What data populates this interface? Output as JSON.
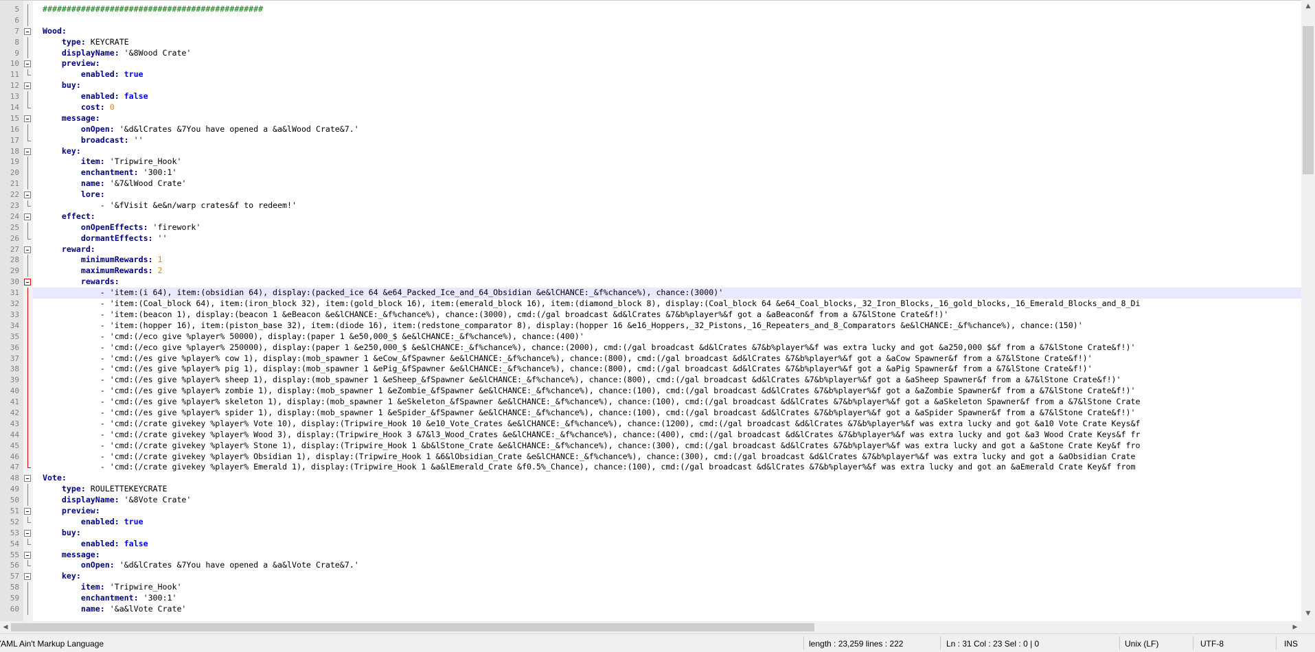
{
  "editor": {
    "lines": [
      {
        "n": "5",
        "fold": "line-v",
        "parts": [
          [
            "cmt",
            "##############################################"
          ]
        ]
      },
      {
        "n": "6",
        "fold": "line-v",
        "parts": []
      },
      {
        "n": "7",
        "fold": "box",
        "parts": [
          [
            "key",
            "Wood:"
          ]
        ]
      },
      {
        "n": "8",
        "fold": "line-v",
        "parts": [
          [
            "",
            "    "
          ],
          [
            "key",
            "type:"
          ],
          [
            "str",
            " KEYCRATE"
          ]
        ]
      },
      {
        "n": "9",
        "fold": "line-v",
        "parts": [
          [
            "",
            "    "
          ],
          [
            "key",
            "displayName:"
          ],
          [
            "str",
            " '&8Wood Crate'"
          ]
        ]
      },
      {
        "n": "10",
        "fold": "box",
        "parts": [
          [
            "",
            "    "
          ],
          [
            "key",
            "preview:"
          ]
        ]
      },
      {
        "n": "11",
        "fold": "end",
        "parts": [
          [
            "",
            "        "
          ],
          [
            "key",
            "enabled:"
          ],
          [
            "bool",
            " true"
          ]
        ]
      },
      {
        "n": "12",
        "fold": "box",
        "parts": [
          [
            "",
            "    "
          ],
          [
            "key",
            "buy:"
          ]
        ]
      },
      {
        "n": "13",
        "fold": "line-v",
        "parts": [
          [
            "",
            "        "
          ],
          [
            "key",
            "enabled:"
          ],
          [
            "bool",
            " false"
          ]
        ]
      },
      {
        "n": "14",
        "fold": "end",
        "parts": [
          [
            "",
            "        "
          ],
          [
            "key",
            "cost:"
          ],
          [
            "num",
            " 0"
          ]
        ]
      },
      {
        "n": "15",
        "fold": "box",
        "parts": [
          [
            "",
            "    "
          ],
          [
            "key",
            "message:"
          ]
        ]
      },
      {
        "n": "16",
        "fold": "line-v",
        "parts": [
          [
            "",
            "        "
          ],
          [
            "key",
            "onOpen:"
          ],
          [
            "str",
            " '&d&lCrates &7You have opened a &a&lWood Crate&7.'"
          ]
        ]
      },
      {
        "n": "17",
        "fold": "end",
        "parts": [
          [
            "",
            "        "
          ],
          [
            "key",
            "broadcast:"
          ],
          [
            "str",
            " ''"
          ]
        ]
      },
      {
        "n": "18",
        "fold": "box",
        "parts": [
          [
            "",
            "    "
          ],
          [
            "key",
            "key:"
          ]
        ]
      },
      {
        "n": "19",
        "fold": "line-v",
        "parts": [
          [
            "",
            "        "
          ],
          [
            "key",
            "item:"
          ],
          [
            "str",
            " 'Tripwire_Hook'"
          ]
        ]
      },
      {
        "n": "20",
        "fold": "line-v",
        "parts": [
          [
            "",
            "        "
          ],
          [
            "key",
            "enchantment:"
          ],
          [
            "str",
            " '300:1'"
          ]
        ]
      },
      {
        "n": "21",
        "fold": "line-v",
        "parts": [
          [
            "",
            "        "
          ],
          [
            "key",
            "name:"
          ],
          [
            "str",
            " '&7&lWood Crate'"
          ]
        ]
      },
      {
        "n": "22",
        "fold": "box",
        "parts": [
          [
            "",
            "        "
          ],
          [
            "key",
            "lore:"
          ]
        ]
      },
      {
        "n": "23",
        "fold": "end",
        "parts": [
          [
            "",
            "            "
          ],
          [
            "str",
            "- '&fVisit &e&n/warp crates&f to redeem!'"
          ]
        ]
      },
      {
        "n": "24",
        "fold": "box",
        "parts": [
          [
            "",
            "    "
          ],
          [
            "key",
            "effect:"
          ]
        ]
      },
      {
        "n": "25",
        "fold": "line-v",
        "parts": [
          [
            "",
            "        "
          ],
          [
            "key",
            "onOpenEffects:"
          ],
          [
            "str",
            " 'firework'"
          ]
        ]
      },
      {
        "n": "26",
        "fold": "end",
        "parts": [
          [
            "",
            "        "
          ],
          [
            "key",
            "dormantEffects:"
          ],
          [
            "str",
            " ''"
          ]
        ]
      },
      {
        "n": "27",
        "fold": "box",
        "parts": [
          [
            "",
            "    "
          ],
          [
            "key",
            "reward:"
          ]
        ]
      },
      {
        "n": "28",
        "fold": "line-v",
        "parts": [
          [
            "",
            "        "
          ],
          [
            "key",
            "minimumRewards:"
          ],
          [
            "num",
            " 1"
          ]
        ]
      },
      {
        "n": "29",
        "fold": "line-v",
        "parts": [
          [
            "",
            "        "
          ],
          [
            "key",
            "maximumRewards:"
          ],
          [
            "num",
            " 2"
          ]
        ]
      },
      {
        "n": "30",
        "fold": "box red",
        "parts": [
          [
            "",
            "        "
          ],
          [
            "key",
            "rewards:"
          ]
        ]
      },
      {
        "n": "31",
        "fold": "line-v red",
        "current": true,
        "parts": [
          [
            "",
            "            "
          ],
          [
            "str",
            "- 'item:(i 64), item:(obsidian 64), display:(packed_ice 64 &e64_Packed_Ice_and_64_Obsidian &e&lCHANCE:_&f%chance%), chance:(3000)'"
          ]
        ]
      },
      {
        "n": "32",
        "fold": "line-v red",
        "parts": [
          [
            "",
            "            "
          ],
          [
            "str",
            "- 'item:(Coal_block 64), item:(iron_block 32), item:(gold_block 16), item:(emerald_block 16), item:(diamond_block 8), display:(Coal_block 64 &e64_Coal_blocks,_32_Iron_Blocks,_16_gold_blocks,_16_Emerald_Blocks_and_8_Di"
          ]
        ]
      },
      {
        "n": "33",
        "fold": "line-v red",
        "parts": [
          [
            "",
            "            "
          ],
          [
            "str",
            "- 'item:(beacon 1), display:(beacon 1 &eBeacon &e&lCHANCE:_&f%chance%), chance:(3000), cmd:(/gal broadcast &d&lCrates &7&b%player%&f got a &aBeacon&f from a &7&lStone Crate&f!)'"
          ]
        ]
      },
      {
        "n": "34",
        "fold": "line-v red",
        "parts": [
          [
            "",
            "            "
          ],
          [
            "str",
            "- 'item:(hopper 16), item:(piston_base 32), item:(diode 16), item:(redstone_comparator 8), display:(hopper 16 &e16_Hoppers,_32_Pistons,_16_Repeaters_and_8_Comparators &e&lCHANCE:_&f%chance%), chance:(150)'"
          ]
        ]
      },
      {
        "n": "35",
        "fold": "line-v red",
        "parts": [
          [
            "",
            "            "
          ],
          [
            "str",
            "- 'cmd:(/eco give %player% 50000), display:(paper 1 &e50,000_$ &e&lCHANCE:_&f%chance%), chance:(400)'"
          ]
        ]
      },
      {
        "n": "36",
        "fold": "line-v red",
        "parts": [
          [
            "",
            "            "
          ],
          [
            "str",
            "- 'cmd:(/eco give %player% 250000), display:(paper 1 &e250,000_$ &e&lCHANCE:_&f%chance%), chance:(2000), cmd:(/gal broadcast &d&lCrates &7&b%player%&f was extra lucky and got &a250,000 $&f from a &7&lStone Crate&f!)'"
          ]
        ]
      },
      {
        "n": "37",
        "fold": "line-v red",
        "parts": [
          [
            "",
            "            "
          ],
          [
            "str",
            "- 'cmd:(/es give %player% cow 1), display:(mob_spawner 1 &eCow_&fSpawner &e&lCHANCE:_&f%chance%), chance:(800), cmd:(/gal broadcast &d&lCrates &7&b%player%&f got a &aCow Spawner&f from a &7&lStone Crate&f!)'"
          ]
        ]
      },
      {
        "n": "38",
        "fold": "line-v red",
        "parts": [
          [
            "",
            "            "
          ],
          [
            "str",
            "- 'cmd:(/es give %player% pig 1), display:(mob_spawner 1 &ePig_&fSpawner &e&lCHANCE:_&f%chance%), chance:(800), cmd:(/gal broadcast &d&lCrates &7&b%player%&f got a &aPig Spawner&f from a &7&lStone Crate&f!)'"
          ]
        ]
      },
      {
        "n": "39",
        "fold": "line-v red",
        "parts": [
          [
            "",
            "            "
          ],
          [
            "str",
            "- 'cmd:(/es give %player% sheep 1), display:(mob_spawner 1 &eSheep_&fSpawner &e&lCHANCE:_&f%chance%), chance:(800), cmd:(/gal broadcast &d&lCrates &7&b%player%&f got a &aSheep Spawner&f from a &7&lStone Crate&f!)'"
          ]
        ]
      },
      {
        "n": "40",
        "fold": "line-v red",
        "parts": [
          [
            "",
            "            "
          ],
          [
            "str",
            "- 'cmd:(/es give %player% zombie 1), display:(mob_spawner 1 &eZombie_&fSpawner &e&lCHANCE:_&f%chance%), chance:(100), cmd:(/gal broadcast &d&lCrates &7&b%player%&f got a &aZombie Spawner&f from a &7&lStone Crate&f!)'"
          ]
        ]
      },
      {
        "n": "41",
        "fold": "line-v red",
        "parts": [
          [
            "",
            "            "
          ],
          [
            "str",
            "- 'cmd:(/es give %player% skeleton 1), display:(mob_spawner 1 &eSkeleton_&fSpawner &e&lCHANCE:_&f%chance%), chance:(100), cmd:(/gal broadcast &d&lCrates &7&b%player%&f got a &aSkeleton Spawner&f from a &7&lStone Crate"
          ]
        ]
      },
      {
        "n": "42",
        "fold": "line-v red",
        "parts": [
          [
            "",
            "            "
          ],
          [
            "str",
            "- 'cmd:(/es give %player% spider 1), display:(mob_spawner 1 &eSpider_&fSpawner &e&lCHANCE:_&f%chance%), chance:(100), cmd:(/gal broadcast &d&lCrates &7&b%player%&f got a &aSpider Spawner&f from a &7&lStone Crate&f!)'"
          ]
        ]
      },
      {
        "n": "43",
        "fold": "line-v red",
        "parts": [
          [
            "",
            "            "
          ],
          [
            "str",
            "- 'cmd:(/crate givekey %player% Vote 10), display:(Tripwire_Hook 10 &e10_Vote_Crates &e&lCHANCE:_&f%chance%), chance:(1200), cmd:(/gal broadcast &d&lCrates &7&b%player%&f was extra lucky and got &a10 Vote Crate Keys&f"
          ]
        ]
      },
      {
        "n": "44",
        "fold": "line-v red",
        "parts": [
          [
            "",
            "            "
          ],
          [
            "str",
            "- 'cmd:(/crate givekey %player% Wood 3), display:(Tripwire_Hook 3 &7&l3_Wood_Crates &e&lCHANCE:_&f%chance%), chance:(400), cmd:(/gal broadcast &d&lCrates &7&b%player%&f was extra lucky and got &a3 Wood Crate Keys&f fr"
          ]
        ]
      },
      {
        "n": "45",
        "fold": "line-v red",
        "parts": [
          [
            "",
            "            "
          ],
          [
            "str",
            "- 'cmd:(/crate givekey %player% Stone 1), display:(Tripwire_Hook 1 &b&lStone_Crate &e&lCHANCE:_&f%chance%), chance:(300), cmd:(/gal broadcast &d&lCrates &7&b%player%&f was extra lucky and got a &aStone Crate Key&f fro"
          ]
        ]
      },
      {
        "n": "46",
        "fold": "line-v red",
        "parts": [
          [
            "",
            "            "
          ],
          [
            "str",
            "- 'cmd:(/crate givekey %player% Obsidian 1), display:(Tripwire_Hook 1 &6&lObsidian_Crate &e&lCHANCE:_&f%chance%), chance:(300), cmd:(/gal broadcast &d&lCrates &7&b%player%&f was extra lucky and got a &aObsidian Crate"
          ]
        ]
      },
      {
        "n": "47",
        "fold": "end red",
        "parts": [
          [
            "",
            "            "
          ],
          [
            "str",
            "- 'cmd:(/crate givekey %player% Emerald 1), display:(Tripwire_Hook 1 &a&lEmerald_Crate &f0.5%_Chance), chance:(100), cmd:(/gal broadcast &d&lCrates &7&b%player%&f was extra lucky and got an &aEmerald Crate Key&f from"
          ]
        ]
      },
      {
        "n": "48",
        "fold": "box",
        "parts": [
          [
            "key",
            "Vote:"
          ]
        ]
      },
      {
        "n": "49",
        "fold": "line-v",
        "parts": [
          [
            "",
            "    "
          ],
          [
            "key",
            "type:"
          ],
          [
            "str",
            " ROULETTEKEYCRATE"
          ]
        ]
      },
      {
        "n": "50",
        "fold": "line-v",
        "parts": [
          [
            "",
            "    "
          ],
          [
            "key",
            "displayName:"
          ],
          [
            "str",
            " '&8Vote Crate'"
          ]
        ]
      },
      {
        "n": "51",
        "fold": "box",
        "parts": [
          [
            "",
            "    "
          ],
          [
            "key",
            "preview:"
          ]
        ]
      },
      {
        "n": "52",
        "fold": "end",
        "parts": [
          [
            "",
            "        "
          ],
          [
            "key",
            "enabled:"
          ],
          [
            "bool",
            " true"
          ]
        ]
      },
      {
        "n": "53",
        "fold": "box",
        "parts": [
          [
            "",
            "    "
          ],
          [
            "key",
            "buy:"
          ]
        ]
      },
      {
        "n": "54",
        "fold": "end",
        "parts": [
          [
            "",
            "        "
          ],
          [
            "key",
            "enabled:"
          ],
          [
            "bool",
            " false"
          ]
        ]
      },
      {
        "n": "55",
        "fold": "box",
        "parts": [
          [
            "",
            "    "
          ],
          [
            "key",
            "message:"
          ]
        ]
      },
      {
        "n": "56",
        "fold": "end",
        "parts": [
          [
            "",
            "        "
          ],
          [
            "key",
            "onOpen:"
          ],
          [
            "str",
            " '&d&lCrates &7You have opened a &a&lVote Crate&7.'"
          ]
        ]
      },
      {
        "n": "57",
        "fold": "box",
        "parts": [
          [
            "",
            "    "
          ],
          [
            "key",
            "key:"
          ]
        ]
      },
      {
        "n": "58",
        "fold": "line-v",
        "parts": [
          [
            "",
            "        "
          ],
          [
            "key",
            "item:"
          ],
          [
            "str",
            " 'Tripwire_Hook'"
          ]
        ]
      },
      {
        "n": "59",
        "fold": "line-v",
        "parts": [
          [
            "",
            "        "
          ],
          [
            "key",
            "enchantment:"
          ],
          [
            "str",
            " '300:1'"
          ]
        ]
      },
      {
        "n": "60",
        "fold": "line-v",
        "parts": [
          [
            "",
            "        "
          ],
          [
            "key",
            "name:"
          ],
          [
            "str",
            " '&a&lVote Crate'"
          ]
        ]
      }
    ]
  },
  "statusbar": {
    "language": "YAML Ain't Markup Language",
    "length": "length : 23,259    lines : 222",
    "position": "Ln : 31    Col : 23    Sel : 0 | 0",
    "eol": "Unix (LF)",
    "encoding": "UTF-8",
    "mode": "INS"
  },
  "icons": {
    "scroll_up": "▲",
    "scroll_down": "▼",
    "scroll_left": "◀",
    "scroll_right": "▶"
  },
  "colors": {
    "key": "#000080",
    "number": "#ff8000",
    "boolean": "#0000ff",
    "comment": "#008000",
    "current_line": "#e8e8ff",
    "fold_marker_active": "#dd0000"
  }
}
